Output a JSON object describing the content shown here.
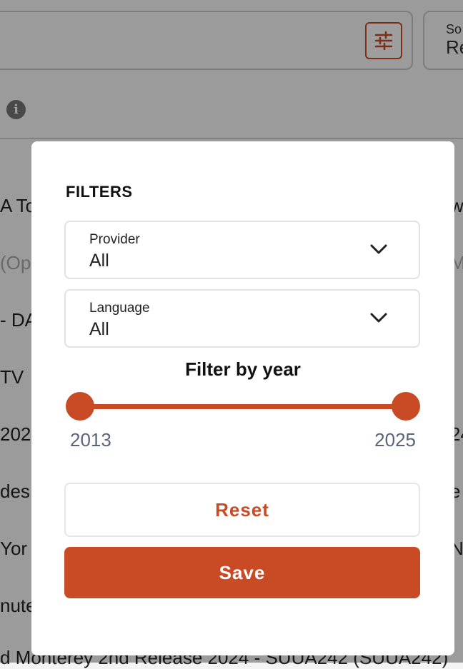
{
  "background": {
    "sort": {
      "label": "So",
      "value": "Re"
    },
    "rows_left": [
      "A To",
      "(Op",
      "- DA",
      "TV",
      "202",
      "des",
      " Yor",
      "nute"
    ],
    "rows_right": [
      "w",
      "M",
      "",
      "",
      "24",
      "e",
      "N",
      ""
    ],
    "bottom_row": "d Monterey 2nd Release 2024 - SUUA242 (SUUA242)"
  },
  "filters": {
    "title": "FILTERS",
    "provider": {
      "label": "Provider",
      "value": "All"
    },
    "language": {
      "label": "Language",
      "value": "All"
    },
    "year_title": "Filter by year",
    "year_min": "2013",
    "year_max": "2025",
    "reset_label": "Reset",
    "save_label": "Save"
  },
  "colors": {
    "accent": "#c84b25",
    "year_text": "#5b6579"
  },
  "icons": {
    "filter": "sliders-icon",
    "info": "info-icon",
    "dropdown": "chevron-down-icon"
  }
}
